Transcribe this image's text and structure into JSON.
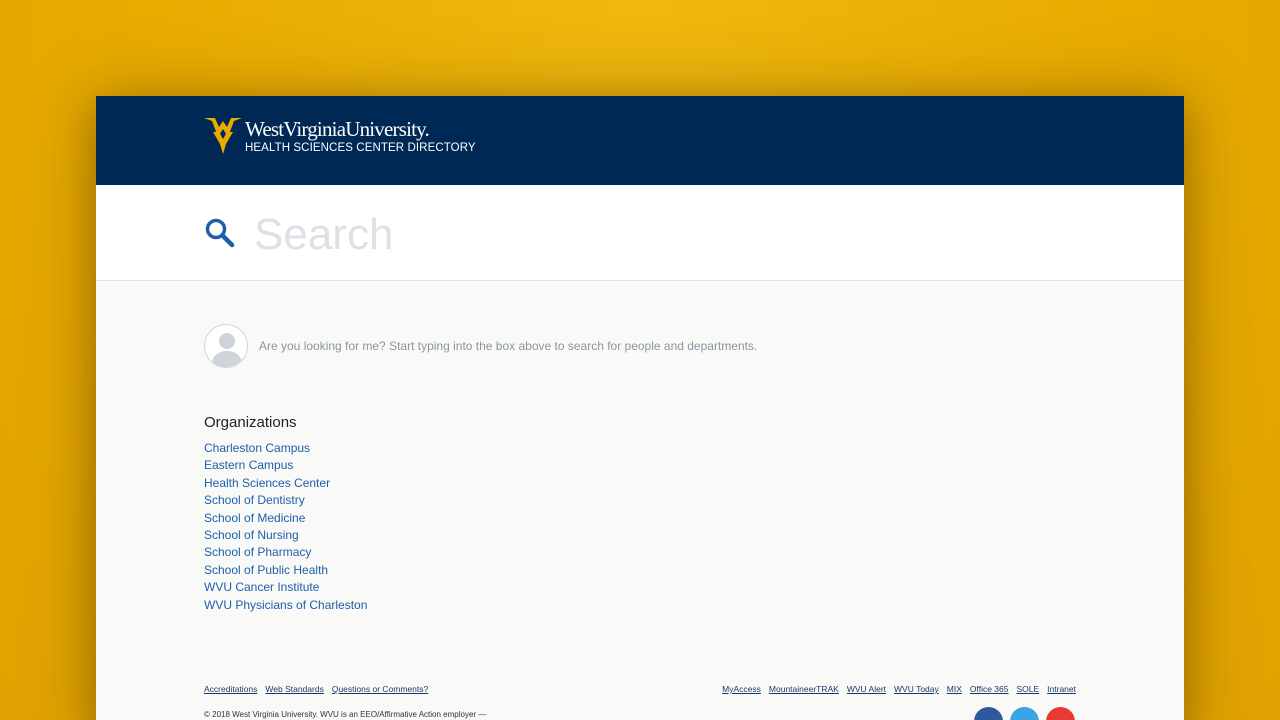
{
  "header": {
    "logo_name": "WestVirginiaUniversity.",
    "logo_subtitle": "HEALTH SCIENCES CENTER DIRECTORY",
    "colors": {
      "navy": "#002855",
      "gold": "#eaaa00"
    }
  },
  "search": {
    "placeholder": "Search",
    "value": "",
    "icon": "search-icon"
  },
  "hint": {
    "icon": "user-avatar-icon",
    "text": "Are you looking for me? Start typing into the box above to search for people and departments."
  },
  "organizations": {
    "title": "Organizations",
    "items": [
      "Charleston Campus",
      "Eastern Campus",
      "Health Sciences Center",
      "School of Dentistry",
      "School of Medicine",
      "School of Nursing",
      "School of Pharmacy",
      "School of Public Health",
      "WVU Cancer Institute",
      "WVU Physicians of Charleston"
    ]
  },
  "footer": {
    "left_links": [
      "Accreditations",
      "Web Standards",
      "Questions or Comments?"
    ],
    "right_links": [
      "MyAccess",
      "MountaineerTRAK",
      "WVU Alert",
      "WVU Today",
      "MIX",
      "Office 365",
      "SOLE",
      "Intranet"
    ],
    "copyright": "© 2018 West Virginia University. WVU is an EEO/Affirmative Action employer —",
    "social": [
      {
        "icon": "facebook-icon",
        "color": "#2d5a9e"
      },
      {
        "icon": "twitter-icon",
        "color": "#3aa4e6"
      },
      {
        "icon": "youtube-icon",
        "color": "#e63a33"
      }
    ]
  }
}
